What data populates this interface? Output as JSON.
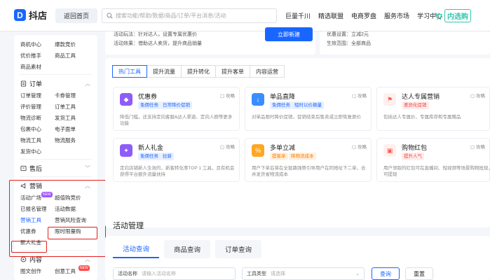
{
  "header": {
    "logo_text": "抖店",
    "home_button": "返回首页",
    "search_placeholder": "搜索功能/帮助/数据/商品/订单/平台消息/活动",
    "nav": [
      "巨量千川",
      "精选联盟",
      "电商罗盘",
      "服务市场",
      "学习中心"
    ],
    "brand_logo_text": "内选购"
  },
  "sidebar": {
    "top_items": [
      "商机中心",
      "爆款竞价",
      "优价推手",
      "商品工具",
      "商品素材"
    ],
    "order_section": {
      "title": "订单",
      "items": [
        "订单管理",
        "卡券管理",
        "评价管理",
        "订单工具",
        "物流诊断",
        "发货工具",
        "包裹中心",
        "电子面单",
        "物流工具",
        "物流服务",
        "发货中心"
      ]
    },
    "aftersale_section": {
      "title": "售后"
    },
    "marketing_section": {
      "title": "营销",
      "items": [
        "活动广场",
        "超值购竞价",
        "已报名管理",
        "活动数据",
        "营销工具",
        "营销风险查询",
        "优惠券",
        "限时限量购",
        "新人礼金"
      ],
      "badge_activity": "NEW",
      "active_item": "营销工具"
    },
    "content_section": {
      "title": "内容",
      "items": [
        "图文创作",
        "创意工具"
      ],
      "badge_new": "NEW"
    }
  },
  "main": {
    "top_card": {
      "line1": "活动玩法：针对达人，设置专属优惠价",
      "line2": "活动效果：借助达人卖货，提升商品销量",
      "button": "立即新建"
    },
    "top_card_right": {
      "line1": "优惠设置：立减2元",
      "line2": "生效范围：全部商品"
    },
    "tabs": [
      "热门工具",
      "提升流量",
      "提升转化",
      "提升客单",
      "内容运营"
    ],
    "active_tab": "热门工具",
    "tools": [
      {
        "title": "优惠券",
        "tags": [
          "免佣任务",
          "日常降价促销"
        ],
        "guide": "攻略",
        "desc": "降低门槛，还支持定向客服&达人渠道、定向人群等更多功能",
        "color": "#8e5cf6",
        "icon": "coupon-icon"
      },
      {
        "title": "单品直降",
        "tags": [
          "免佣任务",
          "短时以价换量"
        ],
        "guide": "攻略",
        "desc": "对单品限时降价促销，促销结束后售卖或立即恢复原价",
        "color": "#3a8dff",
        "icon": "price-drop-icon"
      },
      {
        "title": "达人专属营销",
        "tags": [
          "差异化促销"
        ],
        "guide": "攻略",
        "desc": "包括达人专属价、专属库存和专属赠品",
        "color": "#ff5a4a",
        "icon": "flag-icon"
      },
      {
        "title": "新人礼金",
        "tags": [
          "免佣任务",
          "拉新"
        ],
        "guide": "攻略",
        "desc": "定向店铺新人生效的，新客转化率TOP 1 工具，且有机会获得平台额外流量扶持",
        "color": "#8e5cf6",
        "icon": "gift-icon"
      },
      {
        "title": "多单立减",
        "tags": [
          "提客单",
          "降物流成本"
        ],
        "guide": "攻略",
        "desc": "用户下单后将在全链路强势引导用户在同地址下二单，合并发货省物流成本",
        "color": "#ffa623",
        "icon": "discount-icon"
      },
      {
        "title": "购物红包",
        "tags": [
          "提升人气"
        ],
        "guide": "攻略",
        "desc": "用户领取的红包可在直播间、短视频等场景购物抵现，不可提现",
        "color": "#ff5a4a",
        "icon": "red-packet-icon"
      }
    ],
    "activity": {
      "title": "活动管理",
      "tabs": [
        "活动查询",
        "商品查询",
        "订单查询"
      ],
      "active_tab": "活动查询",
      "name_label": "活动名称",
      "name_placeholder": "请输入活动名称",
      "type_label": "工具类型",
      "type_placeholder": "请选择",
      "query_button": "查询",
      "reset_button": "重置"
    }
  }
}
